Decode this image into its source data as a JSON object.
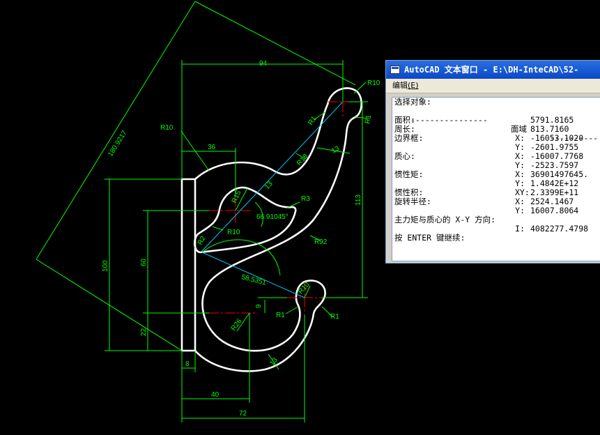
{
  "window": {
    "title": "AutoCAD 文本窗口 - E:\\DH-InteCAD\\52-",
    "menu_label": "编辑",
    "menu_shortcut": "(E)"
  },
  "text_window": {
    "command": "选择对象:",
    "header_dashes_left": "----------------",
    "header_label": "面域",
    "header_dashes_right": "----------",
    "rows": [
      {
        "label": "面积:",
        "axis": "",
        "value": "5791.8165"
      },
      {
        "label": "周长:",
        "axis": "",
        "value": "813.7160"
      },
      {
        "label": "边界框:",
        "axis": "X:",
        "value": "-16053.1020"
      },
      {
        "label": "",
        "axis": "Y:",
        "value": "-2601.9755"
      },
      {
        "label": "质心:",
        "axis": "X:",
        "value": "-16007.7768"
      },
      {
        "label": "",
        "axis": "Y:",
        "value": "-2523.7597"
      },
      {
        "label": "惯性矩:",
        "axis": "X:",
        "value": "36901497645."
      },
      {
        "label": "",
        "axis": "Y:",
        "value": "1.4842E+12"
      },
      {
        "label": "惯性积:",
        "axis": "XY:",
        "value": "2.3399E+11"
      },
      {
        "label": "旋转半径:",
        "axis": "X:",
        "value": "2524.1467"
      },
      {
        "label": "",
        "axis": "Y:",
        "value": "16007.8064"
      },
      {
        "label": "主力矩与质心的 X-Y 方向:",
        "axis": "",
        "value": ""
      },
      {
        "label": "",
        "axis": "I:",
        "value": "4082277.4798"
      }
    ],
    "prompt": "按 ENTER 键继续:"
  },
  "drawing": {
    "dimensions": {
      "d94": "94",
      "d36": "36",
      "d40": "40",
      "d72": "72",
      "d8": "8",
      "d113": "113",
      "d100": "100",
      "d60": "60",
      "d22": "22",
      "d13a": "13",
      "d13b": "13",
      "d9": "9",
      "diag": "180.9217",
      "d58": "58.5351",
      "ang": "66.91045°"
    },
    "radii": {
      "r10_top": "R10",
      "r10_left": "R10",
      "r10_inner": "R10",
      "r10_low": "R10",
      "r1_top": "R1",
      "r1_right": "R1",
      "r1_mid": "R1",
      "r1_low": "R1",
      "r18": "R18",
      "r15": "R15",
      "r3": "R3",
      "r92": "R92",
      "r2": "R2",
      "r26": "R26"
    },
    "colors": {
      "background": "#000000",
      "dimension": "#00ff00",
      "outline": "#ffffff",
      "centerline": "#ff0000",
      "construction": "#00c8ff"
    }
  }
}
